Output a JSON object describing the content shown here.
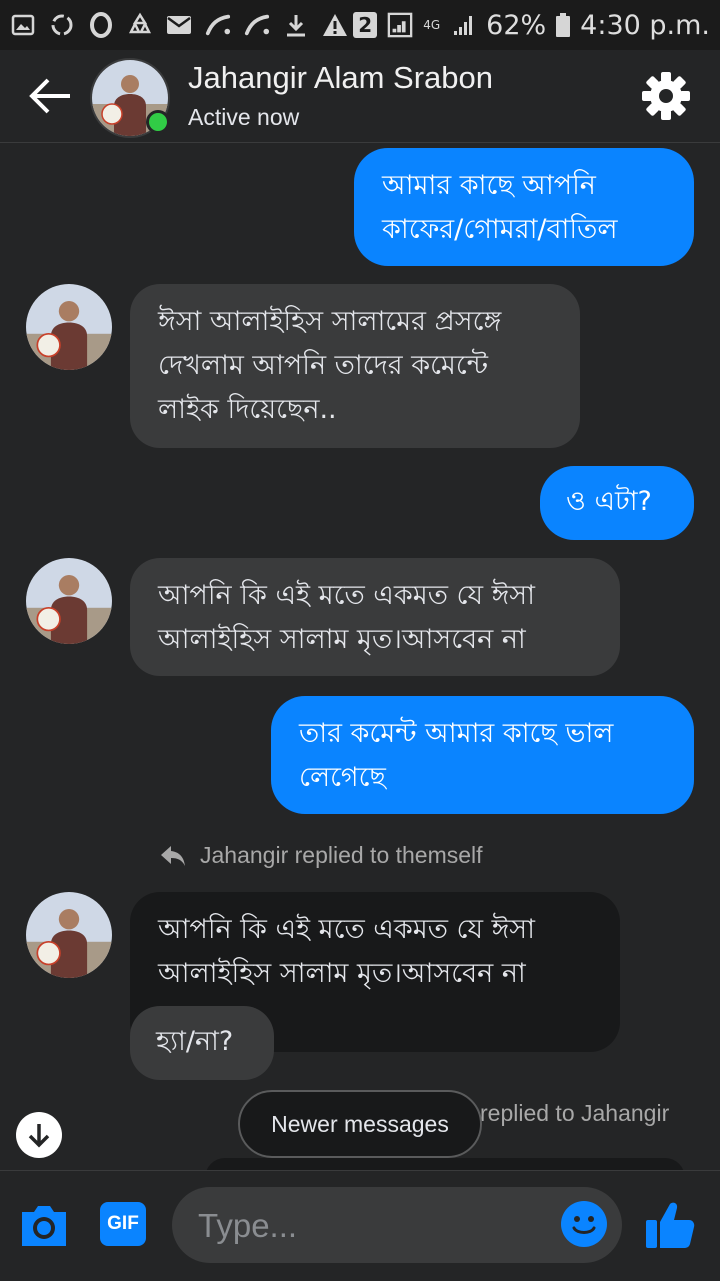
{
  "status_bar": {
    "battery_percent": "62%",
    "time": "4:30 p.m.",
    "sim_slot": "2",
    "network": "4G",
    "left_icons": [
      "gallery-icon",
      "sync-icon",
      "opera-icon",
      "recycle-icon",
      "mail-icon",
      "phone-hook-icon",
      "phone-hook-icon",
      "download-icon",
      "warning-icon"
    ]
  },
  "header": {
    "back_icon": "arrow-left-icon",
    "contact_name": "Jahangir Alam Srabon",
    "status": "Active now",
    "settings_icon": "gear-icon"
  },
  "messages": [
    {
      "direction": "outgoing",
      "text_lines": [
        "আমার কাছে আপনি",
        "কাফের/গোমরা/বাতিল"
      ]
    },
    {
      "direction": "incoming",
      "text_lines": [
        "ঈসা আলাইহিস সালামের প্রসঙ্গে",
        "দেখলাম আপনি তাদের কমেন্টে",
        "লাইক দিয়েছেন.."
      ]
    },
    {
      "direction": "outgoing",
      "text_lines": [
        "ও এটা?"
      ]
    },
    {
      "direction": "incoming",
      "text_lines": [
        "আপনি কি এই মতে একমত যে ঈসা",
        "আলাইহিস সালাম মৃত।আসবেন না"
      ]
    },
    {
      "direction": "outgoing",
      "text_lines": [
        "তার কমেন্ট আমার কাছে ভাল",
        "লেগেছে"
      ]
    },
    {
      "direction": "incoming",
      "text_lines": [
        "আপনি কি এই মতে একমত যে ঈসা",
        "আলাইহিস সালাম মৃত।আসবেন না"
      ]
    },
    {
      "direction": "incoming",
      "text_lines": [
        "হ্যা/না?"
      ]
    }
  ],
  "reply_note": "Jahangir replied to themself",
  "reply_note_2": "replied to Jahangir",
  "newer_messages_label": "Newer messages",
  "composer": {
    "placeholder": "Type...",
    "gif_label": "GIF",
    "icons": [
      "camera-icon",
      "gif-icon",
      "emoji-icon",
      "thumbs-up-icon"
    ]
  },
  "colors": {
    "outgoing_bubble": "#0a84ff",
    "incoming_bubble": "#3a3b3c",
    "background": "#242526",
    "online": "#31cc46"
  }
}
